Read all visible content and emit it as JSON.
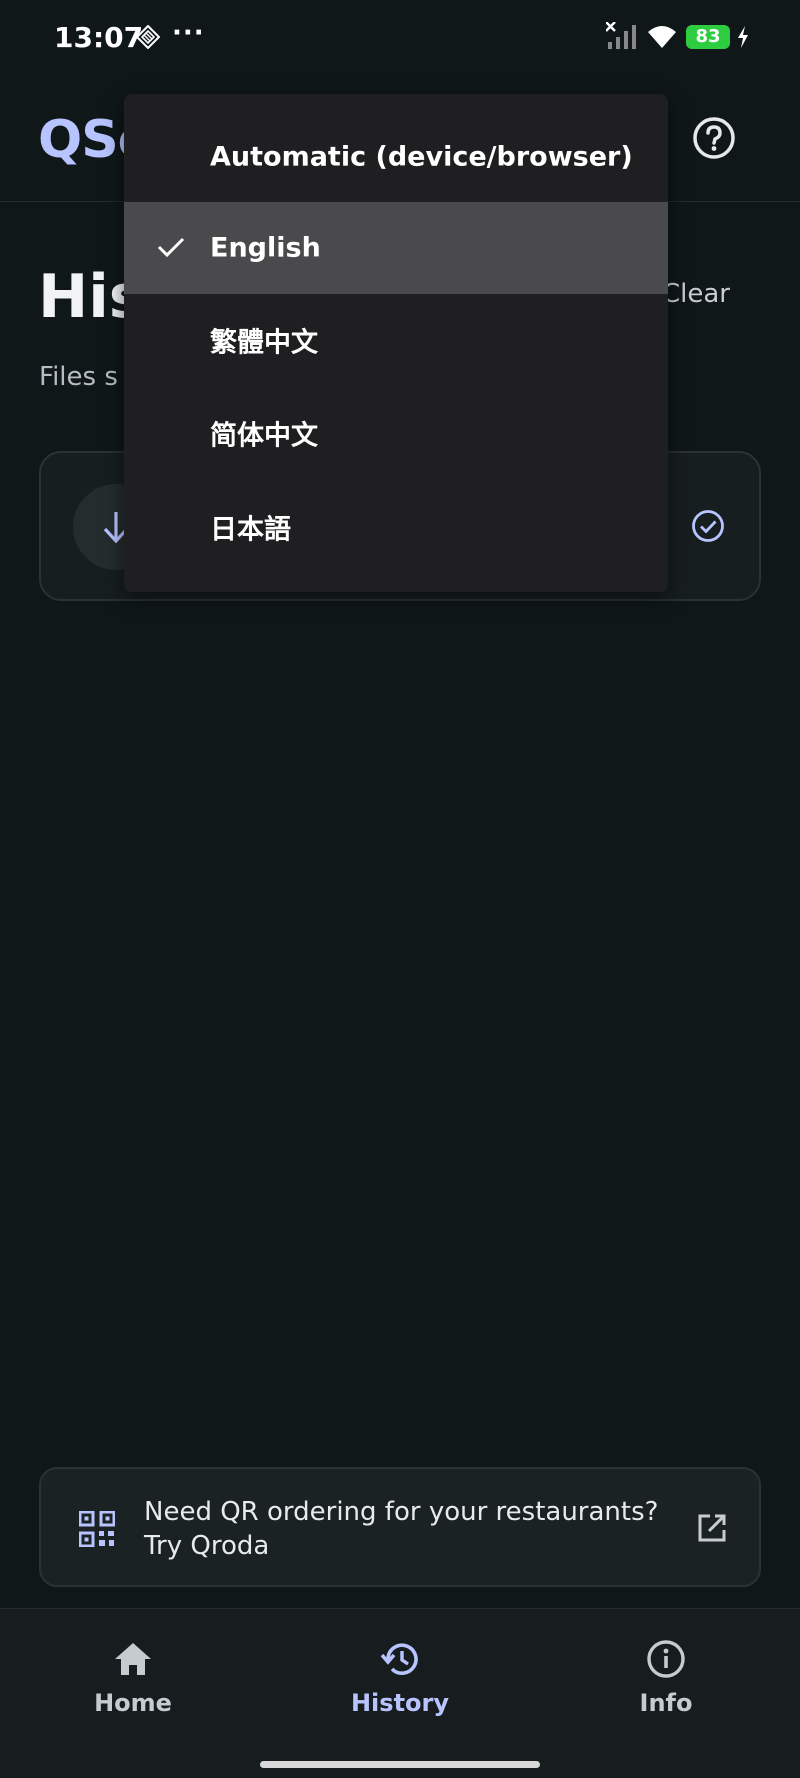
{
  "status_bar": {
    "time": "13:07",
    "more": "···",
    "battery": "83",
    "icons": [
      "app-notification-icon",
      "signal-off-icon",
      "wifi-icon",
      "charging-icon"
    ]
  },
  "header": {
    "logo": "QSe",
    "help_icon": "help-circle-icon"
  },
  "page": {
    "title": "His",
    "clear_label": "Clear",
    "subtitle": "Files s"
  },
  "history_card": {
    "avatar_icon": "arrow-down-icon",
    "status_icon": "check-circle-icon"
  },
  "language_menu": {
    "items": [
      {
        "label": "Automatic (device/browser)",
        "selected": false
      },
      {
        "label": "English",
        "selected": true
      },
      {
        "label": "繁體中文",
        "selected": false
      },
      {
        "label": "简体中文",
        "selected": false
      },
      {
        "label": "日本語",
        "selected": false
      }
    ]
  },
  "promo": {
    "line1": "Need QR ordering for your restaurants?",
    "line2": "Try Qroda",
    "icon": "qr-code-icon",
    "link_icon": "external-link-icon"
  },
  "bottom_nav": {
    "items": [
      {
        "label": "Home",
        "icon": "home-icon",
        "active": false
      },
      {
        "label": "History",
        "icon": "history-icon",
        "active": true
      },
      {
        "label": "Info",
        "icon": "info-icon",
        "active": false
      }
    ]
  },
  "colors": {
    "background": "#0f1718",
    "accent": "#b7c4ff",
    "menu_bg": "#1f1f21",
    "menu_selected": "#4a4a4c",
    "battery": "#2ecc40"
  }
}
